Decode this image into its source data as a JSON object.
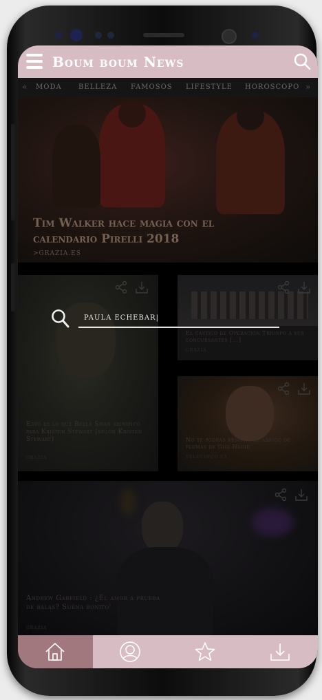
{
  "app": {
    "brand": "Boum boum News"
  },
  "categories": {
    "left_arrow": "«",
    "items": [
      "MODA",
      "BELLEZA",
      "FAMOSOS",
      "LIFESTYLE",
      "HOROSCOPO"
    ],
    "right_arrow": "»"
  },
  "hero": {
    "title": "Tim Walker hace magia con el calendario Pirelli 2018",
    "source": ">GRAZIA.ES"
  },
  "cards": [
    {
      "title": "Esto es lo que Bella Swan significó para Kristen Stewart (según Kristen Stewart)",
      "source": "GRAZIA"
    },
    {
      "title": "El castigo de Operación Triunfo a sus concursantes [...]",
      "source": "GRAZIA"
    },
    {
      "title": "No te podrás resistir al abrigo de plumas de Gigi Hadid",
      "source": "TELECINCO.ES"
    },
    {
      "title": "Andrew Garfield : ¿El amor a prueba de balas? Suena bonito'",
      "source": "GRAZIA"
    }
  ],
  "search": {
    "value": "PAULA ECHEBAR|"
  },
  "nav": {
    "icons": [
      "home-icon",
      "avatar-icon",
      "star-icon",
      "download-icon"
    ],
    "active": "home"
  },
  "colors": {
    "accent": "#d8bcc4",
    "active_tab": "#a0787e"
  }
}
